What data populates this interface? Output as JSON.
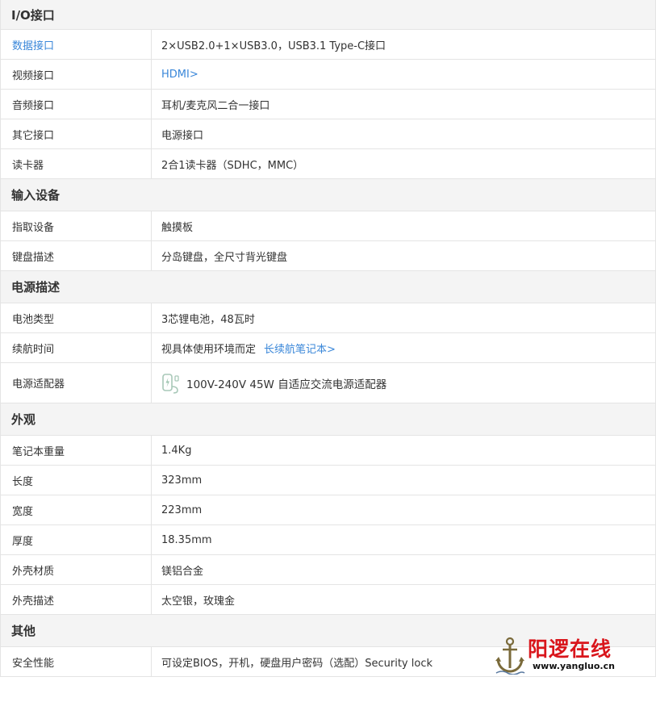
{
  "sections": [
    {
      "title": "I/O接口",
      "rows": [
        {
          "key": "数据接口",
          "value": "2×USB2.0+1×USB3.0，USB3.1 Type-C接口"
        },
        {
          "key": "视频接口",
          "value": "HDMI>"
        },
        {
          "key": "音频接口",
          "value": "耳机/麦克风二合一接口"
        },
        {
          "key": "其它接口",
          "value": "电源接口"
        },
        {
          "key": "读卡器",
          "value": "2合1读卡器（SDHC，MMC）"
        }
      ]
    },
    {
      "title": "输入设备",
      "rows": [
        {
          "key": "指取设备",
          "value": "触摸板"
        },
        {
          "key": "键盘描述",
          "value": "分岛键盘，全尺寸背光键盘"
        }
      ]
    },
    {
      "title": "电源描述",
      "rows": [
        {
          "key": "电池类型",
          "value": "3芯锂电池，48瓦时"
        },
        {
          "key": "续航时间",
          "value": "视具体使用环境而定",
          "link": "长续航笔记本>"
        },
        {
          "key": "电源适配器",
          "value": "100V-240V 45W 自适应交流电源适配器",
          "icon": "charger-icon"
        }
      ]
    },
    {
      "title": "外观",
      "rows": [
        {
          "key": "笔记本重量",
          "value": "1.4Kg"
        },
        {
          "key": "长度",
          "value": "323mm"
        },
        {
          "key": "宽度",
          "value": "223mm"
        },
        {
          "key": "厚度",
          "value": "18.35mm"
        },
        {
          "key": "外壳材质",
          "value": "镁铝合金"
        },
        {
          "key": "外壳描述",
          "value": "太空银，玫瑰金"
        }
      ]
    },
    {
      "title": "其他",
      "rows": [
        {
          "key": "安全性能",
          "value": "可设定BIOS，开机，硬盘用户密码（选配）Security lock"
        }
      ]
    }
  ],
  "watermark": {
    "name": "阳逻在线",
    "url": "www.yangluo.cn",
    "icon": "anchor-icon"
  },
  "colors": {
    "link": "#3a87d9",
    "header_bg": "#f4f4f4",
    "border": "#e4e4e4",
    "watermark_red": "#d9161c"
  }
}
